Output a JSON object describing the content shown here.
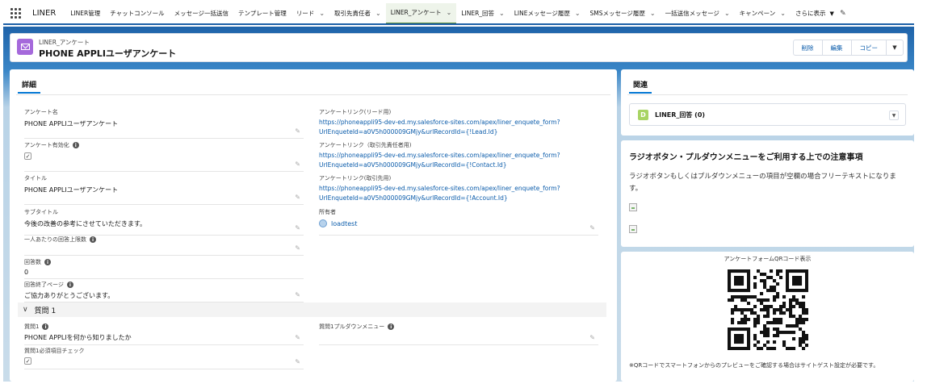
{
  "nav": {
    "app_name": "LINER",
    "items": [
      {
        "label": "LINER管理",
        "chevron": false
      },
      {
        "label": "チャットコンソール",
        "chevron": false
      },
      {
        "label": "メッセージ一括送信",
        "chevron": false
      },
      {
        "label": "テンプレート管理",
        "chevron": false
      },
      {
        "label": "リード",
        "chevron": true
      },
      {
        "label": "取引先責任者",
        "chevron": true
      },
      {
        "label": "LINER_アンケート",
        "chevron": true,
        "active": true
      },
      {
        "label": "LINER_回答",
        "chevron": true
      },
      {
        "label": "LINEメッセージ履歴",
        "chevron": true
      },
      {
        "label": "SMSメッセージ履歴",
        "chevron": true
      },
      {
        "label": "一括送信メッセージ",
        "chevron": true
      },
      {
        "label": "キャンペーン",
        "chevron": true
      }
    ],
    "more_label": "さらに表示"
  },
  "header": {
    "object_label": "LINER_アンケート",
    "record_title": "PHONE APPLIユーザアンケート",
    "buttons": {
      "delete": "削除",
      "edit": "編集",
      "copy": "コピー"
    }
  },
  "detail": {
    "tab_label": "詳細",
    "fields": {
      "name": {
        "label": "アンケート名",
        "value": "PHONE APPLIユーザアンケート"
      },
      "enabled": {
        "label": "アンケート有効化",
        "checked": true
      },
      "title": {
        "label": "タイトル",
        "value": "PHONE APPLIユーザアンケート"
      },
      "subtitle": {
        "label": "サブタイトル",
        "value": "今後の改善の参考にさせていただきます。"
      },
      "limit": {
        "label": "一人あたりの回答上限数",
        "value": ""
      },
      "answers": {
        "label": "回答数",
        "value": "0"
      },
      "end_page": {
        "label": "回答終了ページ",
        "value": "ご協力ありがとうございます。"
      },
      "link_lead": {
        "label": "アンケートリンク(リード用)",
        "line1": "https://phoneappli95-dev-ed.my.salesforce-sites.com/apex/liner_enquete_form?",
        "line2": "UrlEnqueteId=a0V5h000009GMjy&urlRecordId={!Lead.Id}"
      },
      "link_contact": {
        "label": "アンケートリンク（取引先責任者用)",
        "line1": "https://phoneappli95-dev-ed.my.salesforce-sites.com/apex/liner_enquete_form?",
        "line2": "UrlEnqueteId=a0V5h000009GMjy&urlRecordId={!Contact.Id}"
      },
      "link_account": {
        "label": "アンケートリンク(取引先用)",
        "line1": "https://phoneappli95-dev-ed.my.salesforce-sites.com/apex/liner_enquete_form?",
        "line2": "UrlEnqueteId=a0V5h000009GMjy&urlRecordId={!Account.Id}"
      },
      "owner": {
        "label": "所有者",
        "value": "loadtest"
      }
    },
    "section": {
      "label": "質問 1"
    },
    "q_fields": {
      "q1": {
        "label": "質問1",
        "value": "PHONE APPLIを何から知りましたか"
      },
      "q1_dropdown": {
        "label": "質問1プルダウンメニュー",
        "value": ""
      },
      "q1_required": {
        "label": "質問1必須項目チェック",
        "checked": true
      }
    }
  },
  "related": {
    "tab_label": "関連",
    "item": {
      "icon_letter": "D",
      "title": "LINER_回答 (0)"
    }
  },
  "notice": {
    "title": "ラジオボタン・プルダウンメニューをご利用する上での注意事項",
    "body": "ラジオボタンもしくはプルダウンメニューの項目が空欄の場合フリーテキストになります。"
  },
  "qr": {
    "title": "アンケートフォームQRコード表示",
    "note": "※QRコードでスマートフォンからのプレビューをご確認する場合はサイトゲスト設定が必要です。"
  }
}
